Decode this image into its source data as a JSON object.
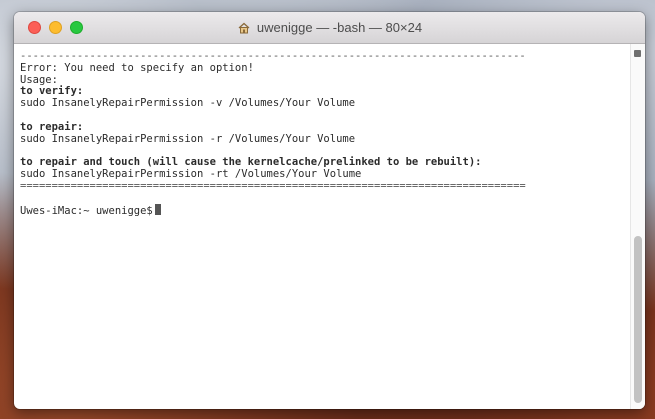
{
  "window": {
    "title": "uwenigge — -bash — 80×24"
  },
  "terminal": {
    "lines": [
      "--------------------------------------------------------------------------------",
      "Error: You need to specify an option!",
      "Usage:",
      "to verify:",
      "sudo InsanelyRepairPermission -v /Volumes/Your Volume",
      "",
      "to repair:",
      "sudo InsanelyRepairPermission -r /Volumes/Your Volume",
      "",
      "to repair and touch (will cause the kernelcache/prelinked to be rebuilt):",
      "sudo InsanelyRepairPermission -rt /Volumes/Your Volume",
      "================================================================================",
      "",
      "Uwes-iMac:~ uwenigge$"
    ]
  }
}
